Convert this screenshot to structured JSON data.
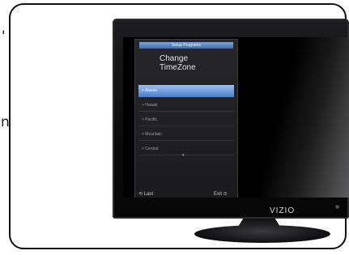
{
  "page_edge_left": {
    "top_char": "'",
    "bottom_char": "n"
  },
  "tv": {
    "brand": "VIZIO",
    "osd": {
      "title_bar": "Setup Programs",
      "heading_line1": "Change",
      "heading_line2": "TimeZone",
      "items": [
        {
          "label": "> Alaska",
          "selected": true
        },
        {
          "label": "> Hawaii",
          "selected": false
        },
        {
          "label": "> Pacific",
          "selected": false
        },
        {
          "label": "> Mountain",
          "selected": false
        },
        {
          "label": "> Central",
          "selected": false
        }
      ],
      "more_indicator": "▾",
      "footer": {
        "last_label": "⟲ Last",
        "exit_label": "Exit ⊙"
      }
    }
  }
}
